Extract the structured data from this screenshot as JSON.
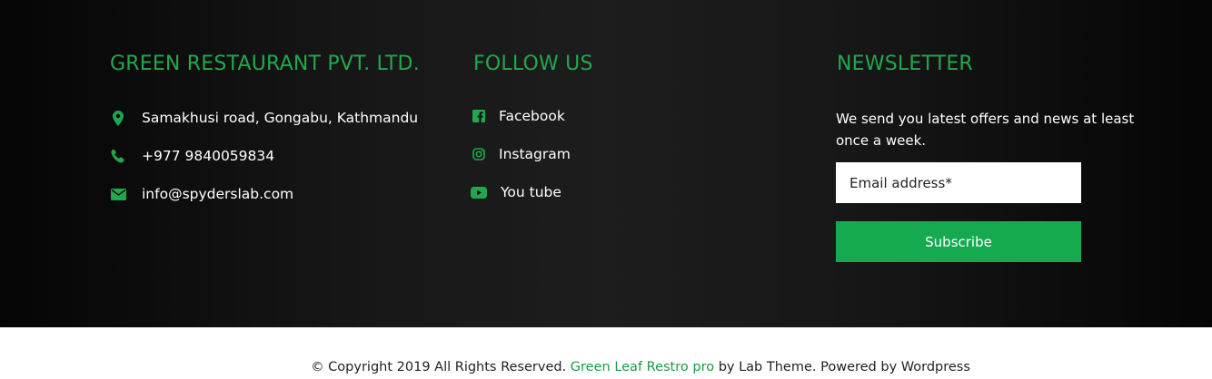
{
  "company": {
    "title": "GREEN RESTAURANT PVT. LTD.",
    "items": [
      {
        "icon": "map-marker-icon",
        "text": "Samakhusi road, Gongabu, Kathmandu"
      },
      {
        "icon": "phone-icon",
        "text": "+977 9840059834"
      },
      {
        "icon": "envelope-icon",
        "text": "info@spyderslab.com"
      }
    ]
  },
  "follow": {
    "title": "FOLLOW US",
    "items": [
      {
        "icon": "facebook-icon",
        "text": "Facebook"
      },
      {
        "icon": "instagram-icon",
        "text": "Instagram"
      },
      {
        "icon": "youtube-icon",
        "text": "You tube"
      }
    ]
  },
  "newsletter": {
    "title": "NEWSLETTER",
    "description": "We send you latest offers and news at least once a week.",
    "email_placeholder": "Email address*",
    "button_label": "Subscribe"
  },
  "copyright": {
    "prefix": "© Copyright 2019 All Rights Reserved.",
    "link_text": "Green Leaf Restro pro",
    "suffix": "by Lab Theme. Powered by Wordpress"
  },
  "colors": {
    "accent": "#21a84e",
    "button": "#15aa50",
    "footer_bg": "#111111"
  }
}
